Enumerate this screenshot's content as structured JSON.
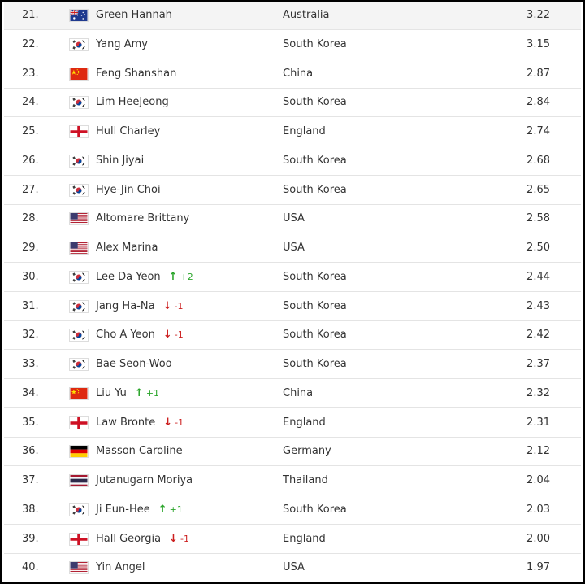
{
  "rankings": [
    {
      "rank": "21.",
      "flag": "australia-flag-icon",
      "name": "Green Hannah",
      "move": "",
      "move_dir": "",
      "country": "Australia",
      "points": "3.22"
    },
    {
      "rank": "22.",
      "flag": "south-korea-flag-icon",
      "name": "Yang Amy",
      "move": "",
      "move_dir": "",
      "country": "South Korea",
      "points": "3.15"
    },
    {
      "rank": "23.",
      "flag": "china-flag-icon",
      "name": "Feng Shanshan",
      "move": "",
      "move_dir": "",
      "country": "China",
      "points": "2.87"
    },
    {
      "rank": "24.",
      "flag": "south-korea-flag-icon",
      "name": "Lim HeeJeong",
      "move": "",
      "move_dir": "",
      "country": "South Korea",
      "points": "2.84"
    },
    {
      "rank": "25.",
      "flag": "england-flag-icon",
      "name": "Hull Charley",
      "move": "",
      "move_dir": "",
      "country": "England",
      "points": "2.74"
    },
    {
      "rank": "26.",
      "flag": "south-korea-flag-icon",
      "name": "Shin Jiyai",
      "move": "",
      "move_dir": "",
      "country": "South Korea",
      "points": "2.68"
    },
    {
      "rank": "27.",
      "flag": "south-korea-flag-icon",
      "name": "Hye-Jin Choi",
      "move": "",
      "move_dir": "",
      "country": "South Korea",
      "points": "2.65"
    },
    {
      "rank": "28.",
      "flag": "usa-flag-icon",
      "name": "Altomare Brittany",
      "move": "",
      "move_dir": "",
      "country": "USA",
      "points": "2.58"
    },
    {
      "rank": "29.",
      "flag": "usa-flag-icon",
      "name": "Alex Marina",
      "move": "",
      "move_dir": "",
      "country": "USA",
      "points": "2.50"
    },
    {
      "rank": "30.",
      "flag": "south-korea-flag-icon",
      "name": "Lee Da Yeon",
      "move": "+2",
      "move_dir": "up",
      "country": "South Korea",
      "points": "2.44"
    },
    {
      "rank": "31.",
      "flag": "south-korea-flag-icon",
      "name": "Jang Ha-Na",
      "move": "-1",
      "move_dir": "down",
      "country": "South Korea",
      "points": "2.43"
    },
    {
      "rank": "32.",
      "flag": "south-korea-flag-icon",
      "name": "Cho A Yeon",
      "move": "-1",
      "move_dir": "down",
      "country": "South Korea",
      "points": "2.42"
    },
    {
      "rank": "33.",
      "flag": "south-korea-flag-icon",
      "name": "Bae Seon-Woo",
      "move": "",
      "move_dir": "",
      "country": "South Korea",
      "points": "2.37"
    },
    {
      "rank": "34.",
      "flag": "china-flag-icon",
      "name": "Liu Yu",
      "move": "+1",
      "move_dir": "up",
      "country": "China",
      "points": "2.32"
    },
    {
      "rank": "35.",
      "flag": "england-flag-icon",
      "name": "Law Bronte",
      "move": "-1",
      "move_dir": "down",
      "country": "England",
      "points": "2.31"
    },
    {
      "rank": "36.",
      "flag": "germany-flag-icon",
      "name": "Masson Caroline",
      "move": "",
      "move_dir": "",
      "country": "Germany",
      "points": "2.12"
    },
    {
      "rank": "37.",
      "flag": "thailand-flag-icon",
      "name": "Jutanugarn Moriya",
      "move": "",
      "move_dir": "",
      "country": "Thailand",
      "points": "2.04"
    },
    {
      "rank": "38.",
      "flag": "south-korea-flag-icon",
      "name": "Ji Eun-Hee",
      "move": "+1",
      "move_dir": "up",
      "country": "South Korea",
      "points": "2.03"
    },
    {
      "rank": "39.",
      "flag": "england-flag-icon",
      "name": "Hall Georgia",
      "move": "-1",
      "move_dir": "down",
      "country": "England",
      "points": "2.00"
    },
    {
      "rank": "40.",
      "flag": "usa-flag-icon",
      "name": "Yin Angel",
      "move": "",
      "move_dir": "",
      "country": "USA",
      "points": "1.97"
    }
  ],
  "colors": {
    "up": "#2aa52a",
    "down": "#cc1f1f",
    "row_border": "#e4e4e4",
    "first_row_bg": "#f4f4f4"
  }
}
